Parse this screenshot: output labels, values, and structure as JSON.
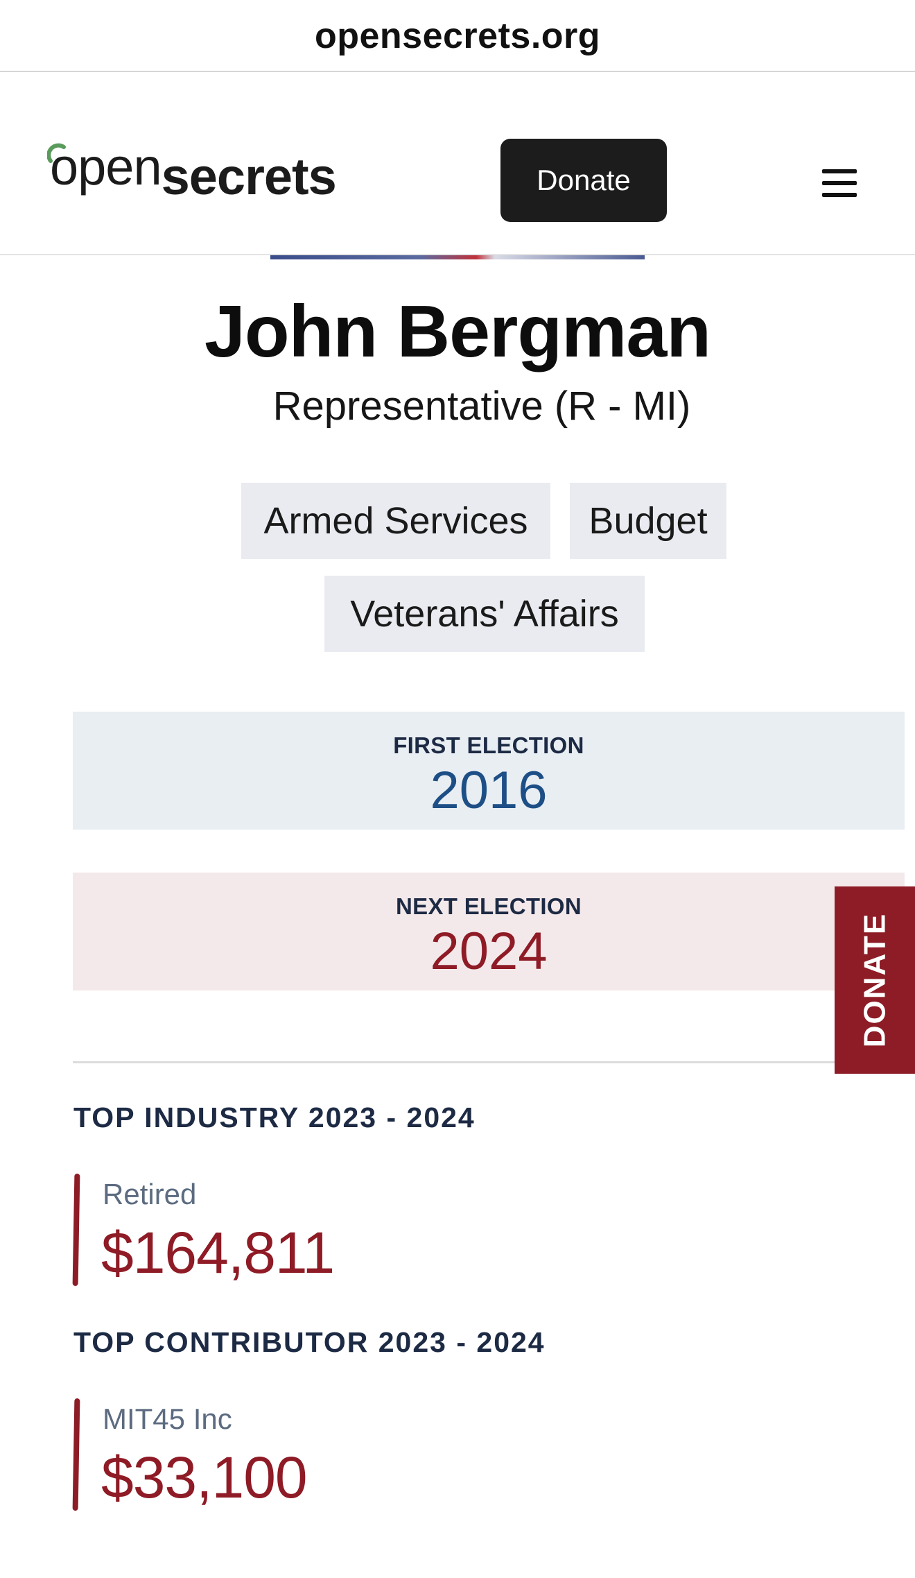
{
  "browser": {
    "url": "opensecrets.org"
  },
  "header": {
    "logo_open": "open",
    "logo_secrets": "secrets",
    "donate_label": "Donate",
    "menu_icon": "hamburger-menu-icon"
  },
  "profile": {
    "name": "John Bergman",
    "role": "Representative (R - MI)",
    "committees": [
      "Armed Services",
      "Budget",
      "Veterans' Affairs"
    ]
  },
  "elections": {
    "first_label": "FIRST ELECTION",
    "first_year": "2016",
    "next_label": "NEXT ELECTION",
    "next_year": "2024"
  },
  "side_tab": {
    "label": "DONATE"
  },
  "top_industry": {
    "title": "TOP INDUSTRY 2023 - 2024",
    "name": "Retired",
    "amount": "$164,811"
  },
  "top_contributor": {
    "title": "TOP CONTRIBUTOR 2023 - 2024",
    "name": "MIT45 Inc",
    "amount": "$33,100"
  },
  "colors": {
    "accent_red": "#8e1b25",
    "accent_blue": "#1d4f86",
    "logo_green": "#5a9b5c",
    "button_dark": "#1c1c1c"
  }
}
